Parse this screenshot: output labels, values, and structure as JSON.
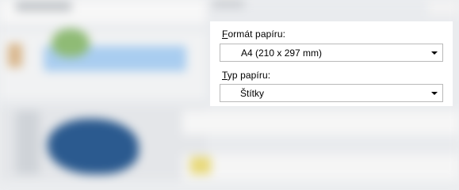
{
  "paper_settings": {
    "format": {
      "label_access_key": "F",
      "label_rest": "ormát papíru:",
      "selected": "A4 (210 x 297 mm)",
      "icon": "chevron-down-icon"
    },
    "type": {
      "label_access_key": "T",
      "label_rest": "yp papíru:",
      "selected": "Štítky",
      "icon": "chevron-down-icon"
    }
  }
}
